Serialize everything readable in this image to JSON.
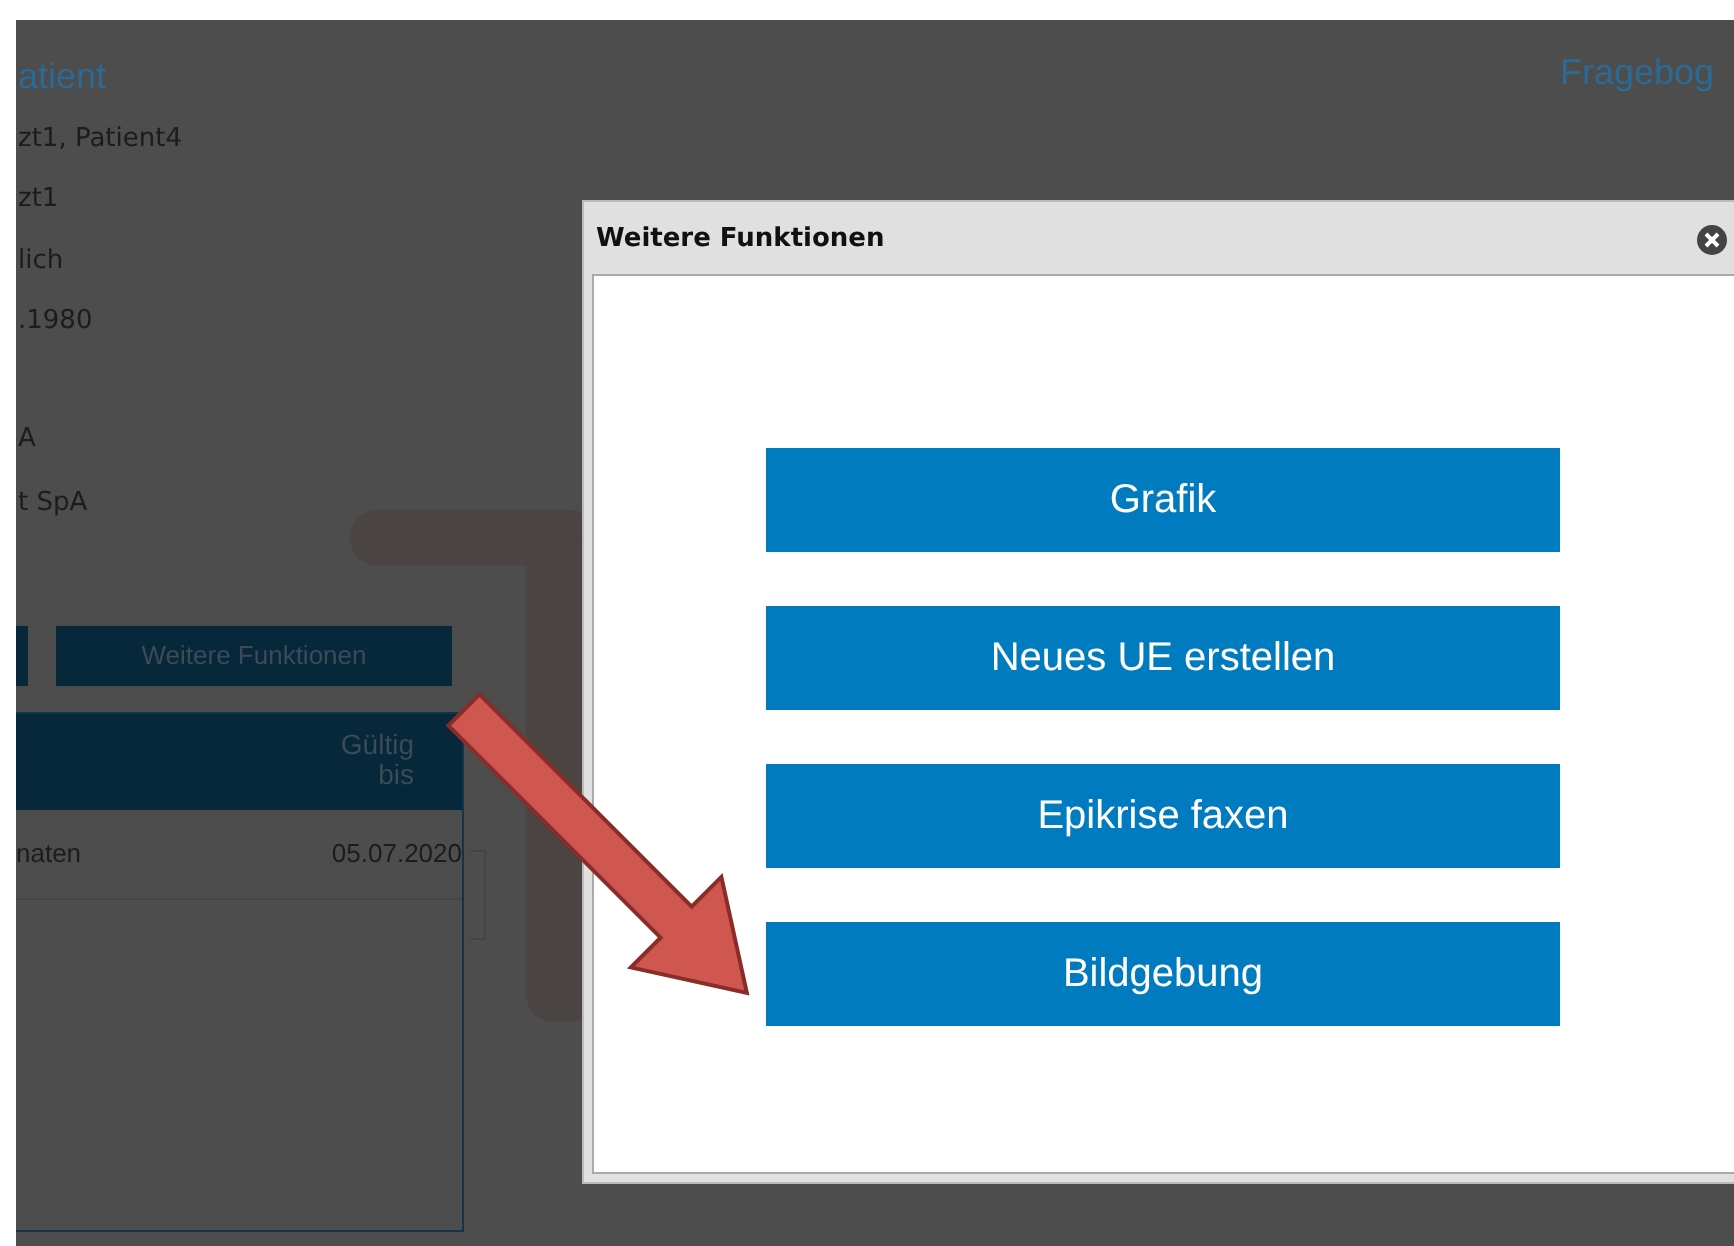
{
  "page": {
    "title": "atient",
    "right_link": "Fragebog",
    "patient_fields": [
      "zt1, Patient4",
      "zt1",
      "lich",
      ".1980",
      "A",
      "t SpA"
    ],
    "buttons": [
      {
        "label": "Weitere Funktionen"
      }
    ],
    "table": {
      "columns": [
        "",
        "Gültig bis"
      ],
      "rows": [
        [
          "naten",
          "05.07.2020"
        ]
      ]
    }
  },
  "dialog": {
    "title": "Weitere Funktionen",
    "buttons": [
      {
        "label": "Grafik"
      },
      {
        "label": "Neues UE erstellen"
      },
      {
        "label": "Epikrise faxen"
      },
      {
        "label": "Bildgebung"
      }
    ]
  }
}
